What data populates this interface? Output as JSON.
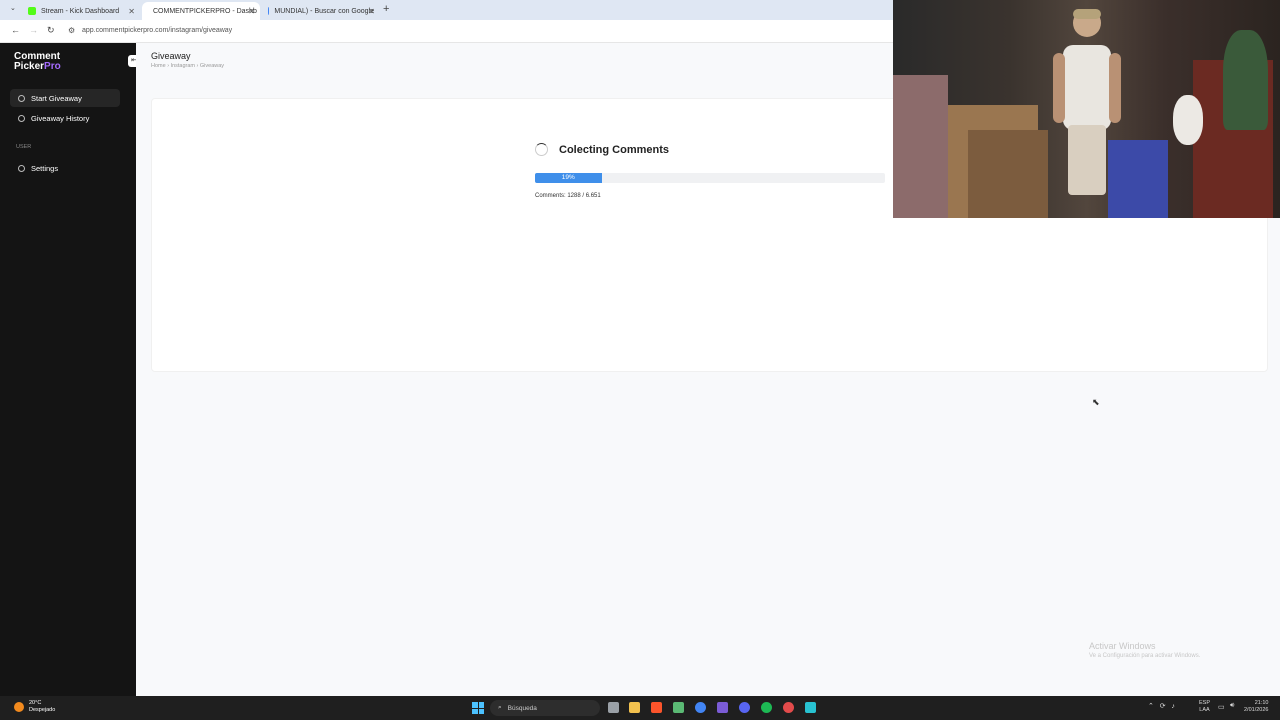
{
  "browser": {
    "tabs": [
      {
        "label": "Stream - Kick Dashboard",
        "favicon_color": "#53fc18"
      },
      {
        "label": "COMMENTPICKERPRO - Dashb",
        "favicon_color": "#a66cff"
      },
      {
        "label": "MUNDIAL) - Buscar con Google",
        "favicon_color": "#4285f4"
      }
    ],
    "url": "app.commentpickerpro.com/instagram/giveaway"
  },
  "sidebar": {
    "logo_line1": "Comment",
    "logo_line2_a": "Picker",
    "logo_line2_b": "Pro",
    "items": [
      {
        "label": "Start Giveaway"
      },
      {
        "label": "Giveaway History"
      }
    ],
    "section_label": "USER",
    "settings_label": "Settings"
  },
  "main": {
    "title": "Giveaway",
    "breadcrumb": "Home  ›  Instagram  ›  Giveaway",
    "status_title": "Colecting Comments",
    "progress_percent": 19,
    "progress_label": "19%",
    "comments_text": "Comments: 1288 / 6.651"
  },
  "watermark": {
    "line1": "Activar Windows",
    "line2": "Ve a Configuración para activar Windows."
  },
  "taskbar": {
    "weather_temp": "20°C",
    "weather_desc": "Despejado",
    "search_placeholder": "Búsqueda",
    "lang_line1": "ESP",
    "lang_line2": "LAA",
    "time": "21:10",
    "date": "2/01/2026"
  },
  "colors": {
    "accent": "#3f8fea",
    "sidebar_bg": "#141414",
    "brand_purple": "#a66cff"
  }
}
